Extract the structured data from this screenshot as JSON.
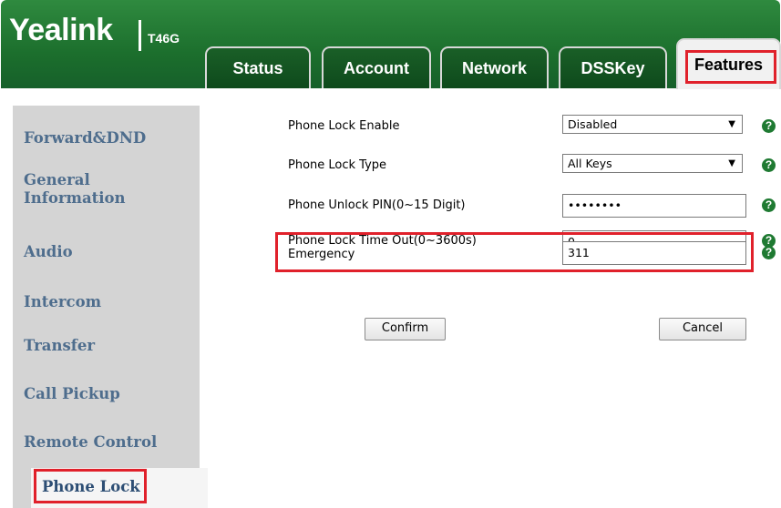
{
  "header": {
    "logo": "Yealink",
    "model": "T46G"
  },
  "tabs": [
    {
      "label": "Status"
    },
    {
      "label": "Account"
    },
    {
      "label": "Network"
    },
    {
      "label": "DSSKey"
    },
    {
      "label": "Features",
      "active": true
    }
  ],
  "sidebar": {
    "items": [
      {
        "label": "Forward&DND"
      },
      {
        "label": "General Information"
      },
      {
        "label": "Audio"
      },
      {
        "label": "Intercom"
      },
      {
        "label": "Transfer"
      },
      {
        "label": "Call Pickup"
      },
      {
        "label": "Remote Control"
      },
      {
        "label": "Phone Lock",
        "active": true
      }
    ]
  },
  "form": {
    "lock_enable": {
      "label": "Phone Lock Enable",
      "value": "Disabled"
    },
    "lock_type": {
      "label": "Phone Lock Type",
      "value": "All Keys"
    },
    "unlock_pin": {
      "label": "Phone Unlock PIN(0~15 Digit)",
      "value": "••••••••"
    },
    "timeout": {
      "label": "Phone Lock Time Out(0~3600s)",
      "value": "0"
    },
    "emergency": {
      "label": "Emergency",
      "value": "311"
    },
    "help_glyph": "?",
    "confirm_label": "Confirm",
    "cancel_label": "Cancel"
  },
  "colors": {
    "header_green": "#1c6f2d",
    "highlight_red": "#e0212b",
    "sidebar_text": "#4e6d8d",
    "sidebar_bg": "#d4d4d4"
  }
}
